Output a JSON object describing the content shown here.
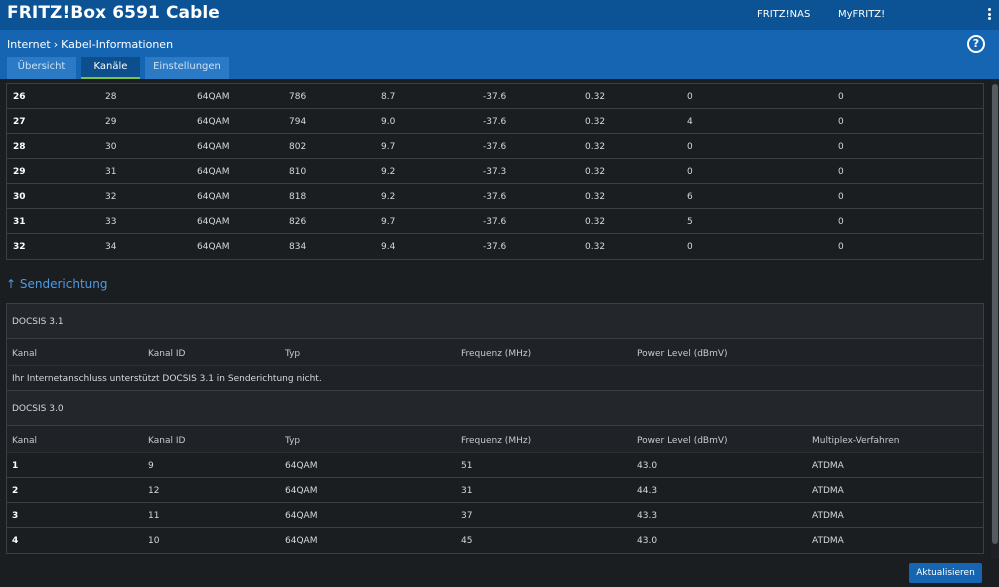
{
  "header": {
    "brand": "FRITZ!Box 6591 Cable",
    "links": [
      "FRITZ!NAS",
      "MyFRITZ!"
    ]
  },
  "breadcrumb": {
    "parent": "Internet",
    "separator": "›",
    "current": "Kabel-Informationen"
  },
  "tabs": [
    {
      "label": "Übersicht",
      "active": false
    },
    {
      "label": "Kanäle",
      "active": true
    },
    {
      "label": "Einstellungen",
      "active": false
    }
  ],
  "downstream_rows": [
    [
      "26",
      "28",
      "64QAM",
      "786",
      "8.7",
      "-37.6",
      "0.32",
      "0",
      "0"
    ],
    [
      "27",
      "29",
      "64QAM",
      "794",
      "9.0",
      "-37.6",
      "0.32",
      "4",
      "0"
    ],
    [
      "28",
      "30",
      "64QAM",
      "802",
      "9.7",
      "-37.6",
      "0.32",
      "0",
      "0"
    ],
    [
      "29",
      "31",
      "64QAM",
      "810",
      "9.2",
      "-37.3",
      "0.32",
      "0",
      "0"
    ],
    [
      "30",
      "32",
      "64QAM",
      "818",
      "9.2",
      "-37.6",
      "0.32",
      "6",
      "0"
    ],
    [
      "31",
      "33",
      "64QAM",
      "826",
      "9.7",
      "-37.6",
      "0.32",
      "5",
      "0"
    ],
    [
      "32",
      "34",
      "64QAM",
      "834",
      "9.4",
      "-37.6",
      "0.32",
      "0",
      "0"
    ]
  ],
  "upstream": {
    "title": "↑ Senderichtung",
    "docsis31": {
      "label": "DOCSIS 3.1",
      "columns": [
        "Kanal",
        "Kanal ID",
        "Typ",
        "Frequenz (MHz)",
        "Power Level (dBmV)"
      ],
      "message": "Ihr Internetanschluss unterstützt DOCSIS 3.1 in Senderichtung nicht."
    },
    "docsis30": {
      "label": "DOCSIS 3.0",
      "columns": [
        "Kanal",
        "Kanal ID",
        "Typ",
        "Frequenz (MHz)",
        "Power Level (dBmV)",
        "Multiplex-Verfahren"
      ],
      "rows": [
        [
          "1",
          "9",
          "64QAM",
          "51",
          "43.0",
          "ATDMA"
        ],
        [
          "2",
          "12",
          "64QAM",
          "31",
          "44.3",
          "ATDMA"
        ],
        [
          "3",
          "11",
          "64QAM",
          "37",
          "43.3",
          "ATDMA"
        ],
        [
          "4",
          "10",
          "64QAM",
          "45",
          "43.0",
          "ATDMA"
        ]
      ]
    }
  },
  "footer": {
    "refresh_label": "Aktualisieren"
  },
  "colors": {
    "topbar": "#0b5394",
    "subbar": "#1565b3",
    "accent": "#4d9be6",
    "active_tab_underline": "#7fc241"
  }
}
